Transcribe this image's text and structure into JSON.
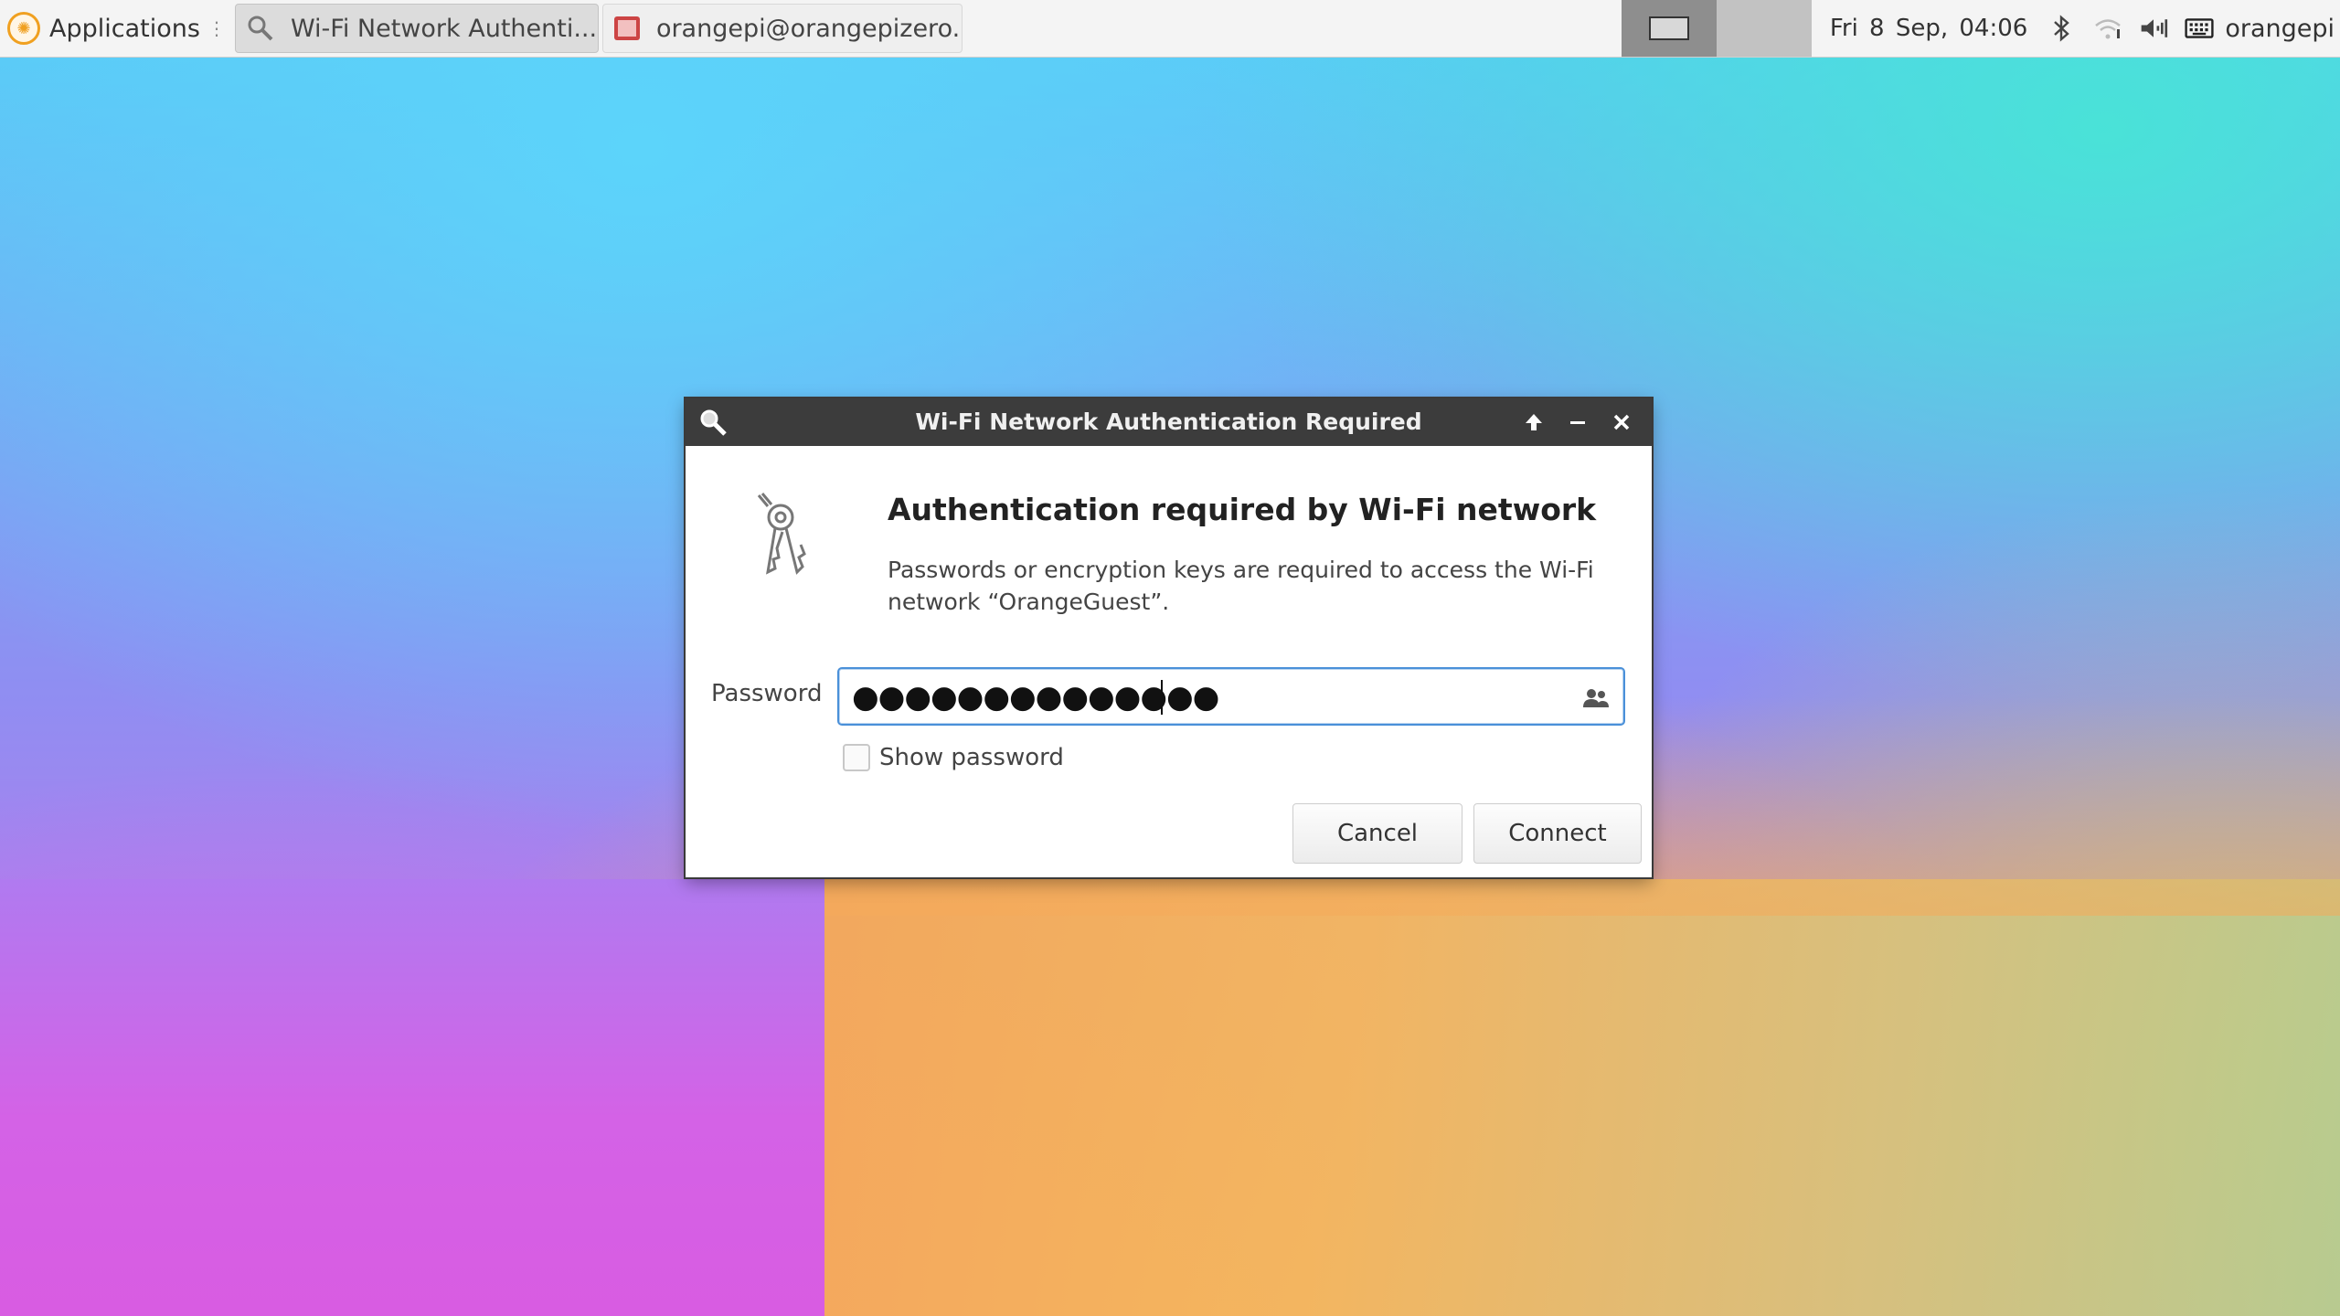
{
  "panel": {
    "applications_label": "Applications",
    "tasks": [
      {
        "label": "Wi-Fi Network Authenti...",
        "icon": "key-search-icon",
        "active": true
      },
      {
        "label": "orangepi@orangepizero...",
        "icon": "terminal-icon",
        "active": false
      }
    ],
    "clock": "Fri  8 Sep, 04:06",
    "user": "orangepi",
    "tray_icons": [
      "bluetooth-icon",
      "wifi-icon",
      "volume-icon",
      "keyboard-icon"
    ]
  },
  "dialog": {
    "title": "Wi-Fi Network Authentication Required",
    "heading": "Authentication required by Wi-Fi network",
    "description": "Passwords or encryption keys are required to access the Wi-Fi network “OrangeGuest”.",
    "password_label": "Password",
    "password_value": "●●●●●●●●●●●●●●",
    "show_password_label": "Show password",
    "show_password_checked": false,
    "cancel_label": "Cancel",
    "connect_label": "Connect"
  },
  "colors": {
    "titlebar": "#3c3c3c",
    "focus": "#4a90d9",
    "panel": "#f4f4f4"
  }
}
